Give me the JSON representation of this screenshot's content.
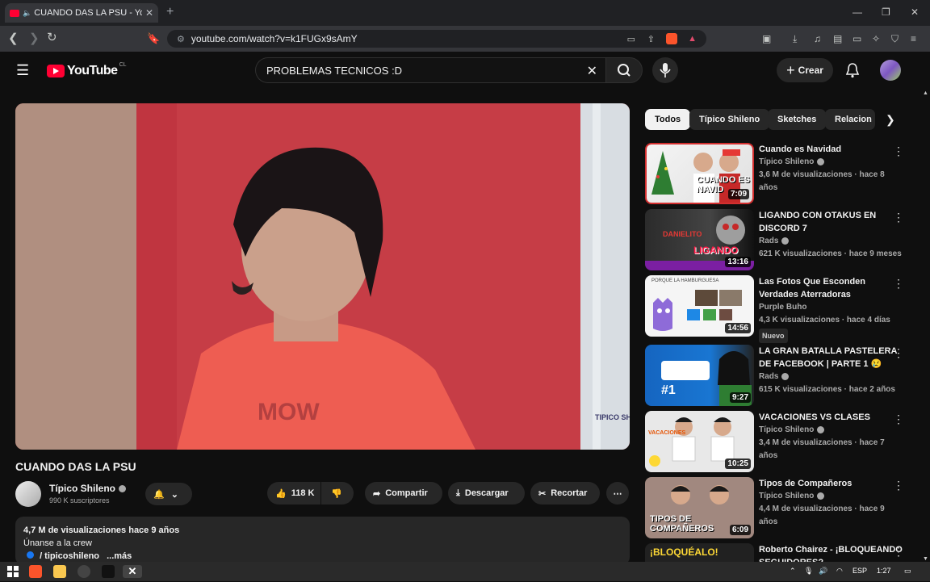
{
  "browser": {
    "tab_title": "CUANDO DAS LA PSU - YouT",
    "url": "youtube.com/watch?v=k1FUGx9sAmY",
    "colors": {
      "tabbar": "#202124",
      "toolbar": "#35363a"
    }
  },
  "youtube": {
    "logo_text": "YouTube",
    "country_code": "CL",
    "search_query": "PROBLEMAS TECNICOS :D",
    "create_label": "Crear",
    "accent_color": "#ff0033"
  },
  "video": {
    "title": "CUANDO DAS LA PSU",
    "watermark": "TIPICO SHILENO",
    "shirt_text": "MOW",
    "channel_name": "Típico Shileno",
    "subscribers": "990 K suscriptores",
    "likes": "118 K",
    "share_label": "Compartir",
    "download_label": "Descargar",
    "clip_label": "Recortar",
    "views_line": "4,7 M de visualizaciones  hace 9 años",
    "desc_line1": "Únanse a la crew",
    "desc_link": "/ tipicoshileno",
    "desc_more": "...más"
  },
  "chips": [
    "Todos",
    "Típico Shileno",
    "Sketches",
    "Relacion"
  ],
  "recommendations": [
    {
      "title": "Cuando es Navidad",
      "channel": "Típico Shileno",
      "verified": true,
      "meta": "3,6 M de visualizaciones · hace 8 años",
      "duration": "7:09",
      "thumb_text": "CUANDO ES NAVID"
    },
    {
      "title": "LIGANDO CON OTAKUS EN DISCORD 7",
      "channel": "Rads",
      "verified": true,
      "meta": "621 K visualizaciones · hace 9 meses",
      "duration": "13:16",
      "thumb_text": "LIGANDO",
      "thumb_name": "DANIELITO"
    },
    {
      "title": "Las Fotos Que Esconden Verdades Aterradoras",
      "channel": "Purple Buho",
      "verified": false,
      "meta": "4,3 K visualizaciones · hace 4 días",
      "duration": "14:56",
      "badge": "Nuevo",
      "thumb_text": "PORQUE LA HAMBURGUESA"
    },
    {
      "title": "LA GRAN BATALLA PASTELERA DE FACEBOOK | PARTE 1 😢",
      "channel": "Rads",
      "verified": true,
      "meta": "615 K visualizaciones · hace 2 años",
      "duration": "9:27",
      "thumb_text": "#1"
    },
    {
      "title": "VACACIONES VS CLASES",
      "channel": "Típico Shileno",
      "verified": true,
      "meta": "3,4 M de visualizaciones · hace 7 años",
      "duration": "10:25",
      "thumb_text": "VACACIONES"
    },
    {
      "title": "Tipos de Compañeros",
      "channel": "Típico Shileno",
      "verified": true,
      "meta": "4,4 M de visualizaciones · hace 9 años",
      "duration": "6:09",
      "thumb_text": "TIPOS DE COMPAÑEROS"
    },
    {
      "title": "Roberto Chairez - ¡BLOQUEANDO SEGUIDORES?",
      "thumb_text": "¡BLOQUÉALO!"
    }
  ],
  "taskbar": {
    "language": "ESP",
    "time": "1:27"
  }
}
